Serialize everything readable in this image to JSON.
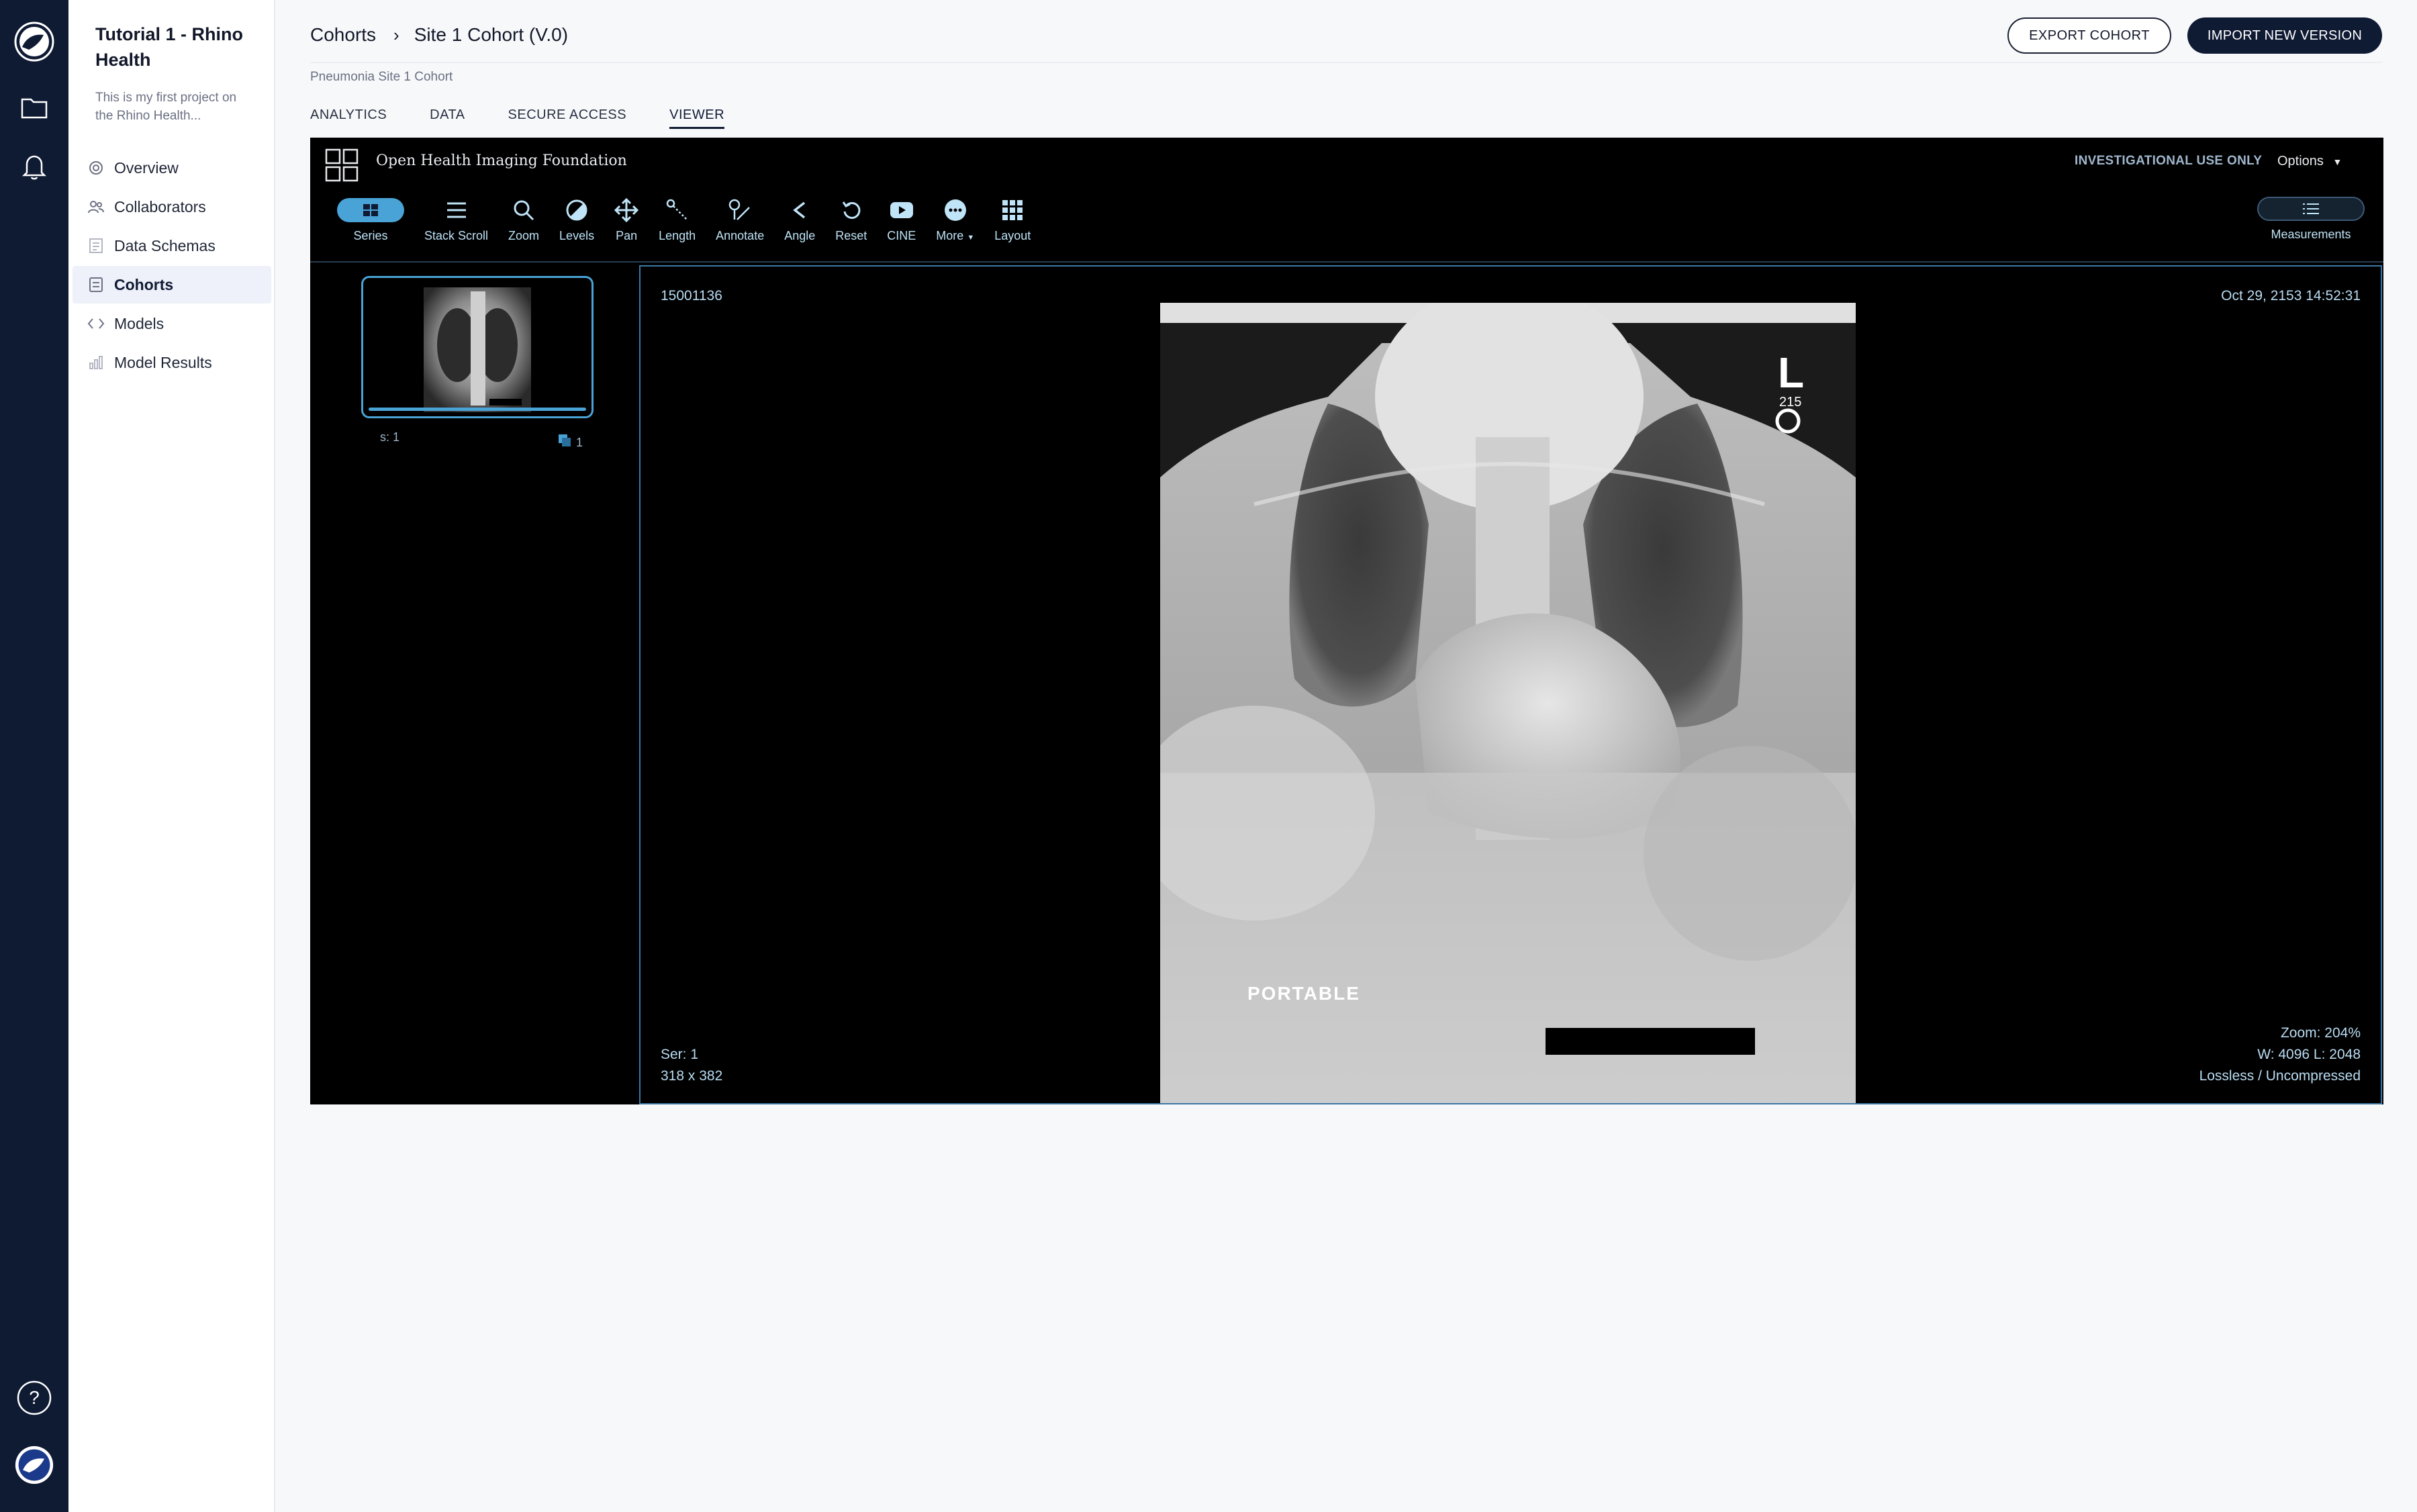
{
  "project": {
    "title": "Tutorial 1 - Rhino Health",
    "description": "This is my first project on the Rhino Health..."
  },
  "nav": [
    {
      "label": "Overview",
      "icon": "overview-icon"
    },
    {
      "label": "Collaborators",
      "icon": "collaborators-icon"
    },
    {
      "label": "Data Schemas",
      "icon": "data-schemas-icon"
    },
    {
      "label": "Cohorts",
      "icon": "cohorts-icon",
      "active": true
    },
    {
      "label": "Models",
      "icon": "code-icon"
    },
    {
      "label": "Model Results",
      "icon": "bar-chart-icon"
    }
  ],
  "header": {
    "breadcrumb_parent": "Cohorts",
    "breadcrumb_current": "Site 1 Cohort (V.0)",
    "subtitle": "Pneumonia Site 1 Cohort",
    "export_label": "EXPORT COHORT",
    "import_label": "IMPORT NEW VERSION"
  },
  "tabs": [
    "ANALYTICS",
    "DATA",
    "SECURE ACCESS",
    "VIEWER"
  ],
  "active_tab": "VIEWER",
  "viewer": {
    "title": "Open Health Imaging Foundation",
    "notice": "INVESTIGATIONAL USE ONLY",
    "options_label": "Options",
    "tools": {
      "series": "Series",
      "stack_scroll": "Stack Scroll",
      "zoom": "Zoom",
      "levels": "Levels",
      "pan": "Pan",
      "length": "Length",
      "annotate": "Annotate",
      "angle": "Angle",
      "reset": "Reset",
      "cine": "CINE",
      "more": "More",
      "layout": "Layout"
    },
    "measurements_label": "Measurements",
    "thumbnail": {
      "series_label": "s: 1",
      "image_count": "1"
    },
    "overlay": {
      "patient_id": "15001136",
      "datetime": "Oct 29, 2153 14:52:31",
      "series": "Ser: 1",
      "dimensions": "318 x 382",
      "zoom": "Zoom: 204%",
      "window_level": "W: 4096 L: 2048",
      "compression": "Lossless / Uncompressed"
    },
    "image_marker": "L",
    "image_marker_sub": "215",
    "image_text": "PORTABLE"
  },
  "colors": {
    "rail": "#0f1a33",
    "accent": "#4aa3d6",
    "viewer_text": "#b9dcf2"
  }
}
